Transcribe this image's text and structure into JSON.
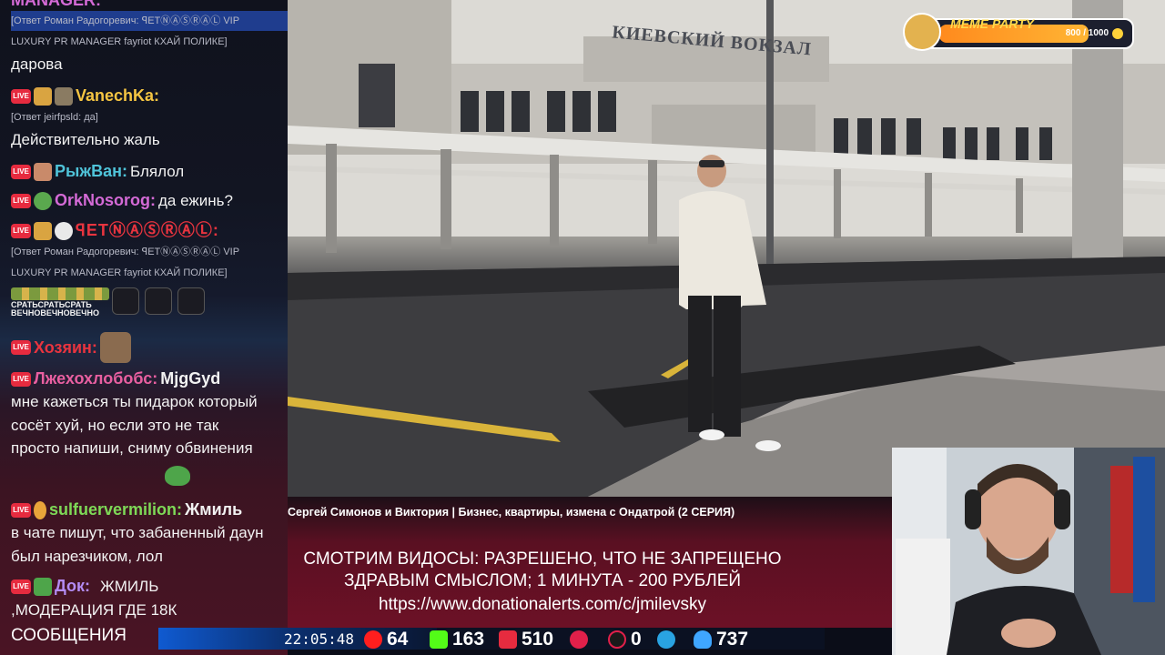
{
  "meme_party": {
    "title": "MEME PARTY",
    "progress": "800 / 1000",
    "progress_fraction": 0.8
  },
  "video": {
    "sign_text": "КИЕВСКИЙ ВОКЗАЛ",
    "title": "Сергей Симонов и Виктория | Бизнес, квартиры, измена с Ондатрой (2 СЕРИЯ)"
  },
  "donation": {
    "line1": "СМОТРИМ ВИДОСЫ: РАЗРЕШЕНО, ЧТО НЕ ЗАПРЕЩЕНО",
    "line2": "ЗДРАВЫМ СМЫСЛОМ; 1 МИНУТА - 200 РУБЛЕЙ",
    "line3": "https://www.donationalerts.com/c/jmilevsky"
  },
  "chat": {
    "top_partial": "MANAGER:",
    "messages": [
      {
        "reply": "[Ответ Роман Радогоревич: ꟼETⓃⒶⓈⓇⒶⓁ VIP",
        "reply2": "LUXURY PR MANAGER fayriot КХАЙ ПОЛИКЕ]",
        "text": "дарова"
      },
      {
        "nick": "VanechKa:",
        "color": "#f5c542",
        "reply": "[Ответ jeirfpsld: да]",
        "text": "Действительно жаль"
      },
      {
        "nick": "РыжВан:",
        "color": "#4fc3d9",
        "text": "Блялол"
      },
      {
        "nick": "OrkNosorog:",
        "color": "#d46ad6",
        "text": "да ежинь?"
      },
      {
        "nick": "ꟼETⓃⒶⓈⓇⒶⓁ:",
        "color": "#e8343f",
        "reply": "[Ответ Роман Радогоревич: ꟼETⓃⒶⓈⓇⒶⓁ VIP",
        "reply2": "LUXURY PR MANAGER fayriot КХАЙ ПОЛИКЕ]",
        "emote_caption1": "СРАТЬСРАТЬСРАТЬ",
        "emote_caption2": "ВЕЧНОВЕЧНОВЕЧНО"
      },
      {
        "nick": "Хозяин:",
        "color": "#e8343f"
      },
      {
        "nick": "Лжехохлобобс:",
        "color": "#e85fa0",
        "mention": "MjgGyd",
        "text": "мне кажеться ты пидарок который сосёт хуй, но если это не так просто напиши, сниму обвинения"
      },
      {
        "nick": "sulfuervermilion:",
        "color": "#7ed957",
        "mention": "Жмиль",
        "text": "в чате пишут, что забаненный даун был нарезчиком, лол"
      },
      {
        "nick": "Док:",
        "color": "#b48cf5",
        "text": "ЖМИЛЬ ,МОДЕРАЦИЯ ГДЕ 18К"
      }
    ],
    "bottom_label": "СООБЩЕНИЯ"
  },
  "status_bar": {
    "clock": "22:05:48",
    "youtube": "64",
    "kick": "163",
    "live": "510",
    "rutube": "",
    "r_count": "0",
    "telegram": "",
    "viewers": "737"
  },
  "colors": {
    "live_badge": "#e62b3f",
    "youtube": "#ff1e1e",
    "kick": "#53fc18",
    "telegram": "#29a3e2",
    "viewers": "#3fa6ff"
  }
}
